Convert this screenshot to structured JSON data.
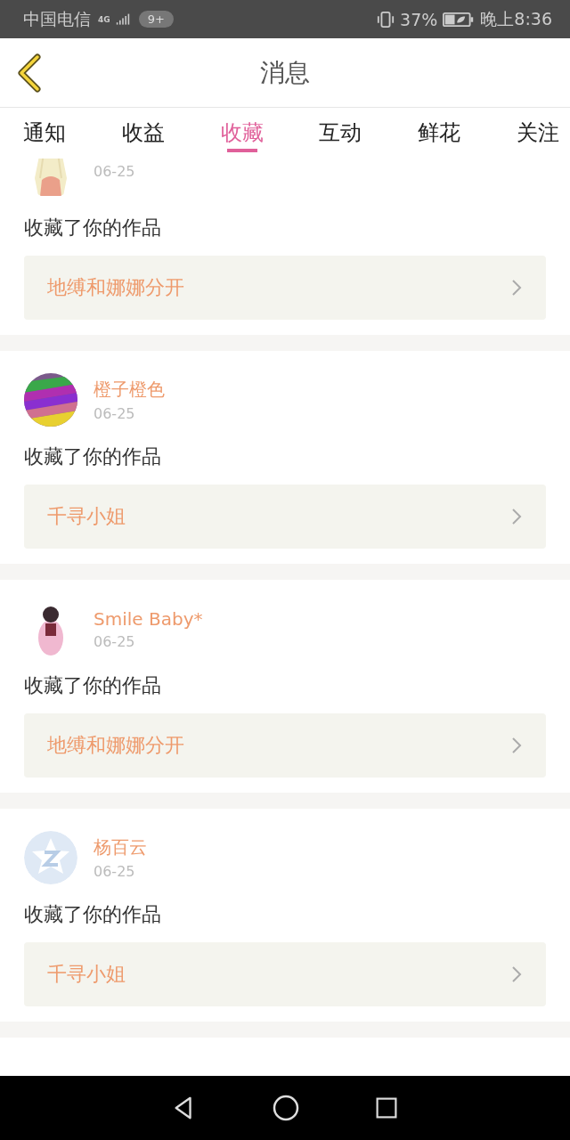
{
  "status_bar": {
    "carrier": "中国电信",
    "network": "4G",
    "badge": "9+",
    "battery": "37%",
    "time": "晚上8:36"
  },
  "header": {
    "title": "消息"
  },
  "tabs": [
    {
      "label": "通知",
      "selected": false
    },
    {
      "label": "收益",
      "selected": false
    },
    {
      "label": "收藏",
      "selected": true
    },
    {
      "label": "互动",
      "selected": false
    },
    {
      "label": "鲜花",
      "selected": false
    },
    {
      "label": "关注",
      "selected": false
    }
  ],
  "messages": [
    {
      "date": "06-25",
      "action": "收藏了你的作品",
      "work": "地缚和娜娜分开"
    },
    {
      "user": "橙子橙色",
      "date": "06-25",
      "action": "收藏了你的作品",
      "work": "千寻小姐"
    },
    {
      "user": "Smile Baby*",
      "date": "06-25",
      "action": "收藏了你的作品",
      "work": "地缚和娜娜分开"
    },
    {
      "avatar": {
        "kind": "default"
      },
      "user": "杨百云",
      "date": "06-25",
      "action": "收藏了你的作品",
      "work": "千寻小姐"
    }
  ]
}
